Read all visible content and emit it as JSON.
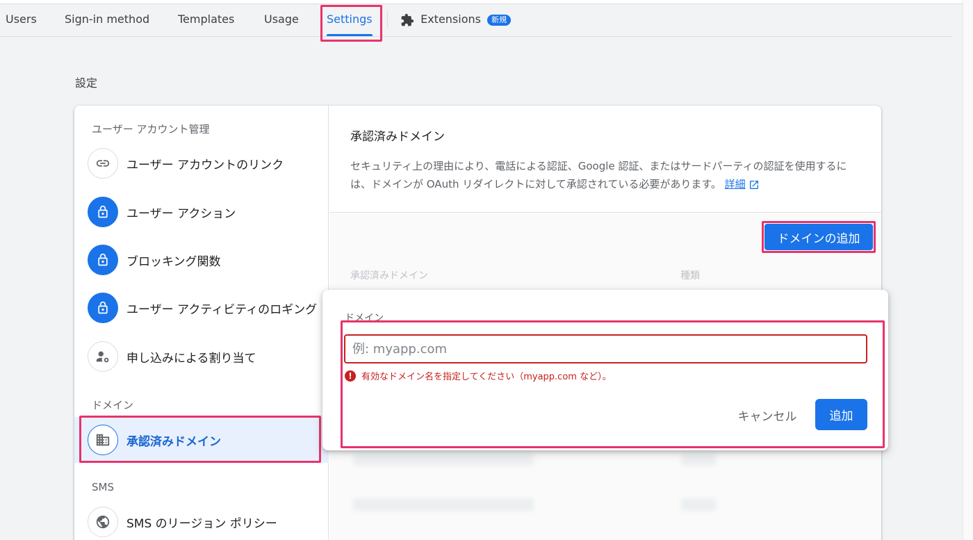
{
  "tabs": [
    {
      "label": "Users"
    },
    {
      "label": "Sign-in method"
    },
    {
      "label": "Templates"
    },
    {
      "label": "Usage"
    },
    {
      "label": "Settings",
      "active": true
    }
  ],
  "extensions_tab": {
    "label": "Extensions",
    "badge": "新規"
  },
  "page_title": "設定",
  "sidebar": {
    "section_user_accounts": "ユーザー アカウント管理",
    "section_domain": "ドメイン",
    "section_sms": "SMS",
    "items": [
      {
        "label": "ユーザー アカウントのリンク",
        "icon": "link-icon"
      },
      {
        "label": "ユーザー アクション",
        "icon": "lock-icon"
      },
      {
        "label": "ブロッキング関数",
        "icon": "lock-icon"
      },
      {
        "label": "ユーザー アクティビティのロギング",
        "icon": "lock-icon"
      },
      {
        "label": "申し込みによる割り当て",
        "icon": "person-gear-icon"
      },
      {
        "label": "承認済みドメイン",
        "icon": "domain-icon",
        "selected": true
      },
      {
        "label": "SMS のリージョン ポリシー",
        "icon": "globe-icon"
      }
    ]
  },
  "main": {
    "title": "承認済みドメイン",
    "description": "セキュリティ上の理由により、電話による認証、Google 認証、またはサードパーティの認証を使用するには、ドメインが OAuth リダイレクトに対して承認されている必要があります。",
    "details_link": "詳細",
    "add_domain_button": "ドメインの追加",
    "columns": [
      "承認済みドメイン",
      "種類"
    ]
  },
  "dialog": {
    "label": "ドメイン",
    "input_placeholder": "例: myapp.com",
    "input_value": "",
    "error": "有効なドメイン名を指定してください（myapp.com など）。",
    "cancel": "キャンセル",
    "add": "追加"
  },
  "colors": {
    "accent": "#1a73e8",
    "error": "#c5221f",
    "highlight": "#e8336b"
  }
}
